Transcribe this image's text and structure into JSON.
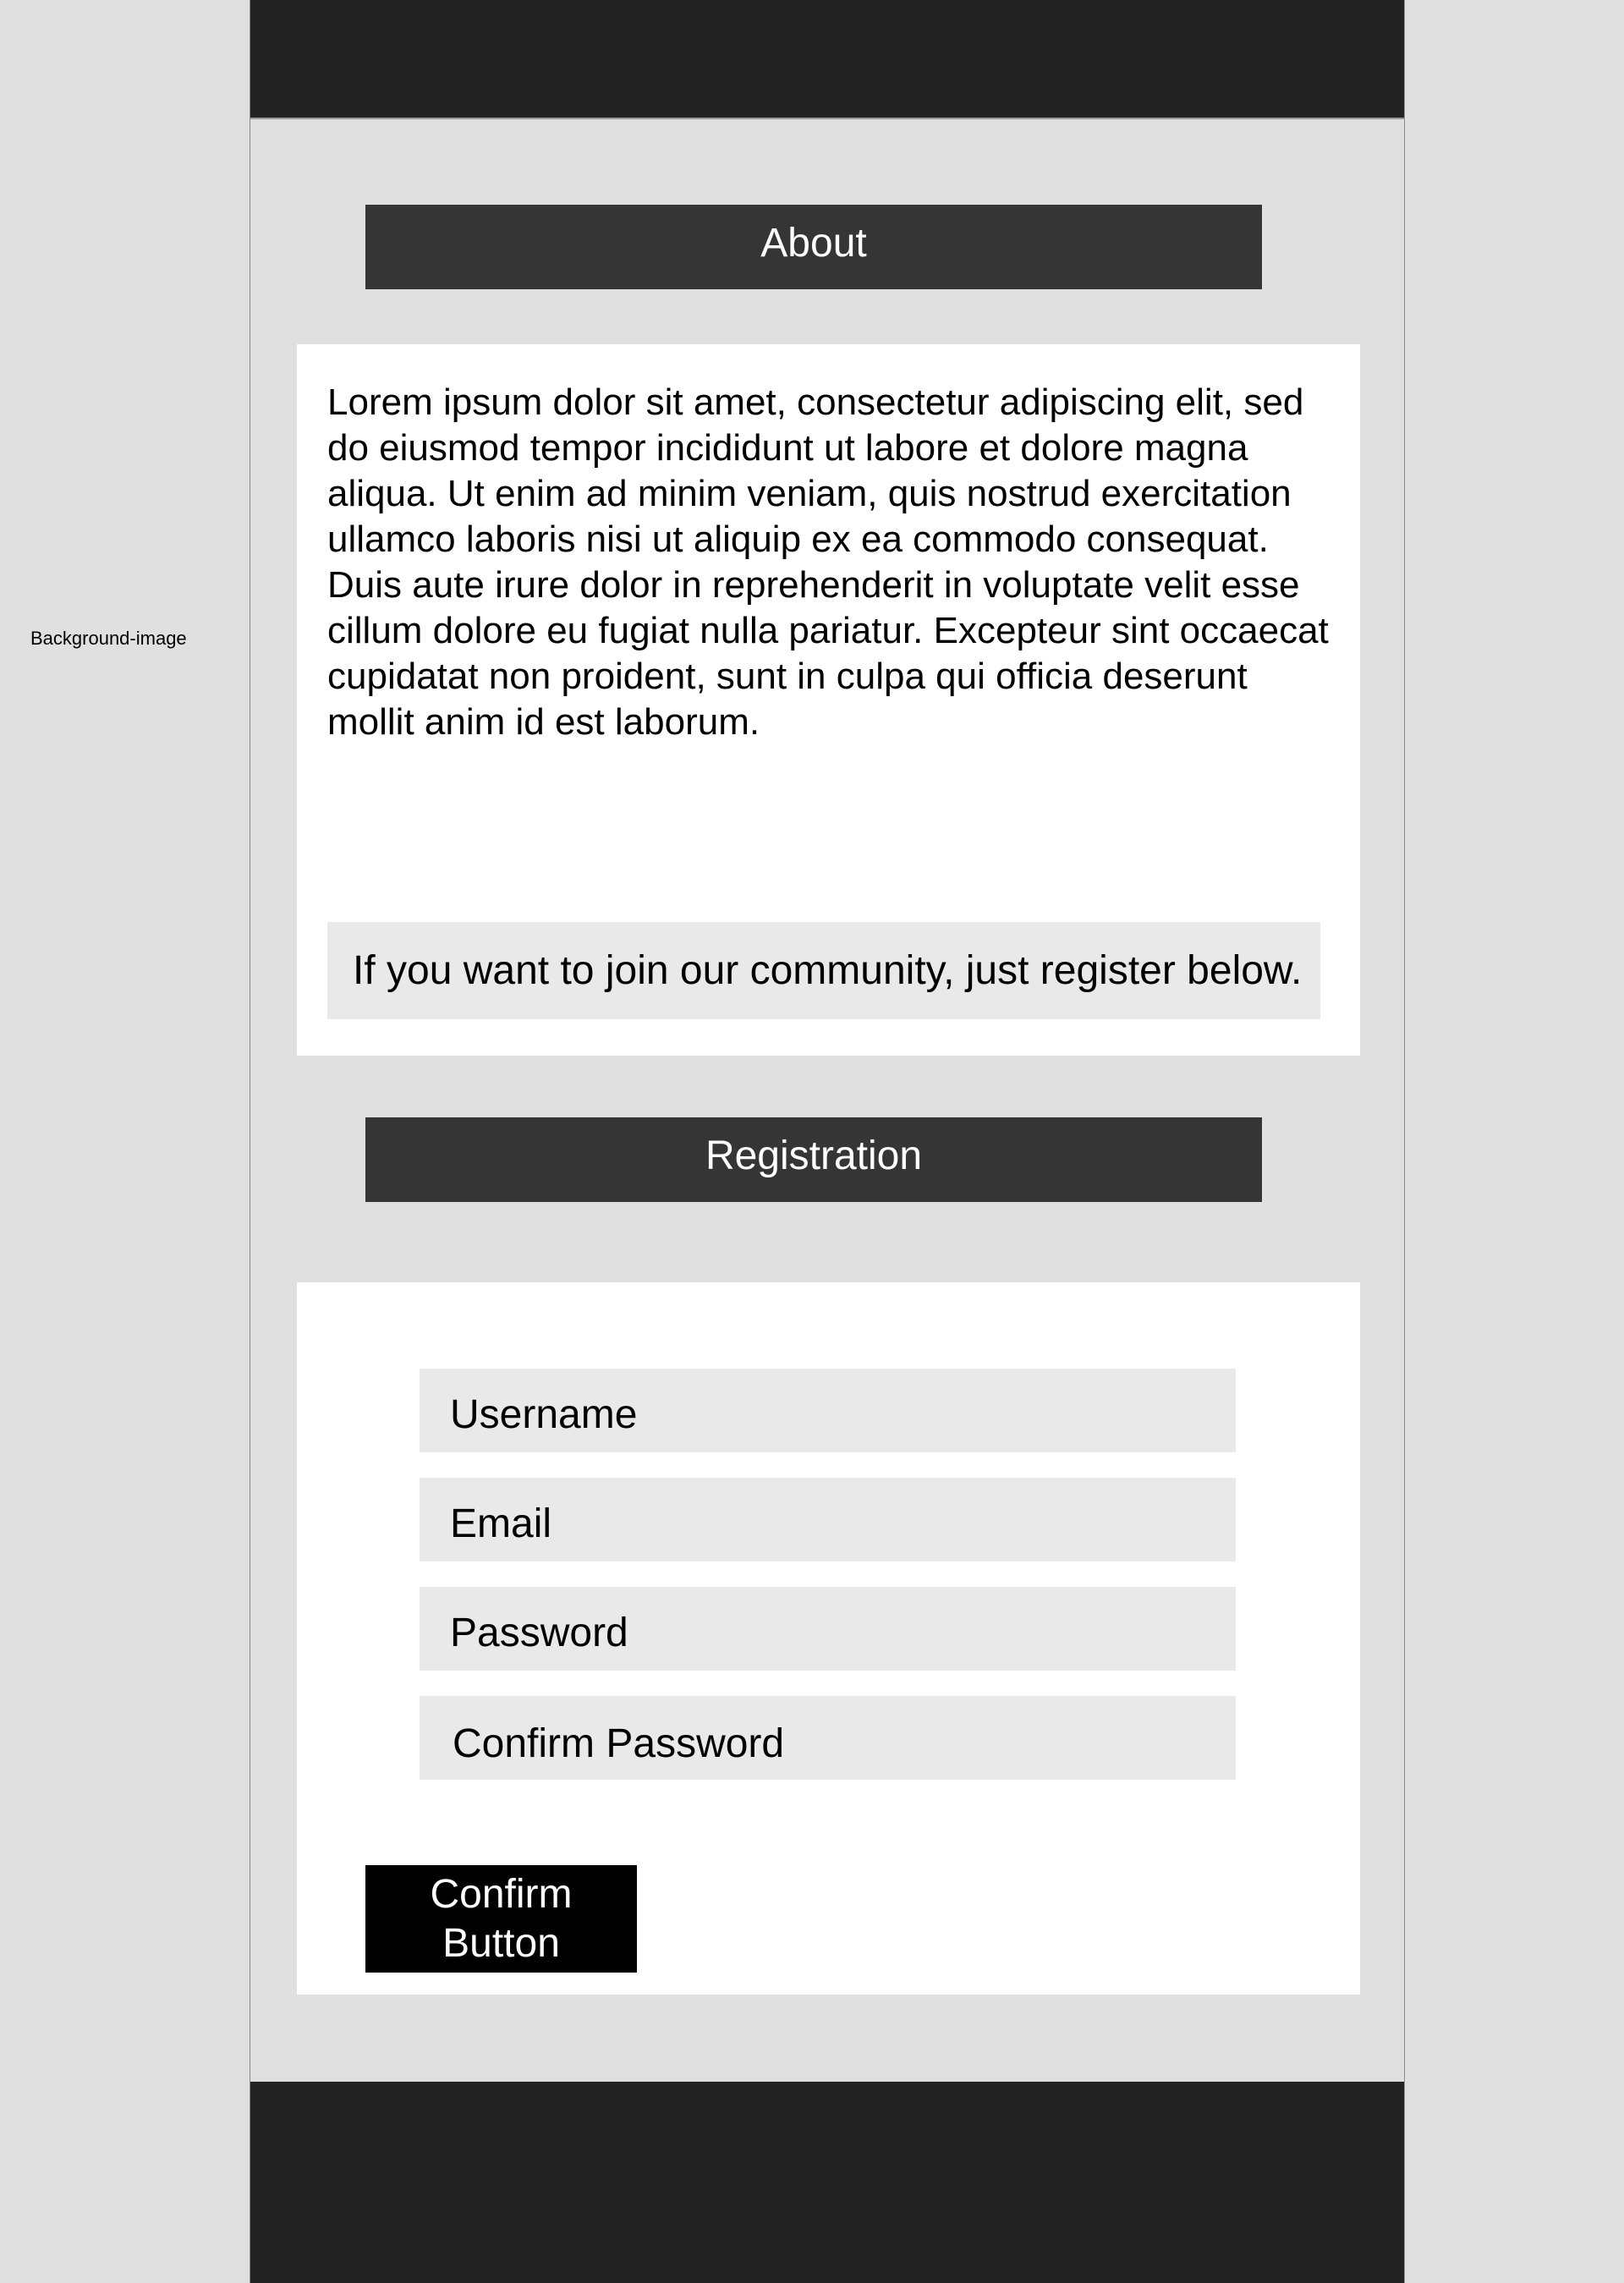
{
  "background": {
    "label": "Background-image"
  },
  "about": {
    "heading": "About",
    "body": "Lorem ipsum dolor sit amet, consectetur adipiscing elit, sed do eiusmod tempor incididunt ut labore et dolore magna aliqua. Ut enim ad minim veniam, quis nostrud exercitation ullamco laboris nisi ut aliquip ex ea commodo consequat. Duis aute irure dolor in reprehenderit in voluptate velit esse cillum dolore eu fugiat nulla pariatur. Excepteur sint occaecat cupidatat non proident, sunt in culpa qui officia deserunt mollit anim id est laborum.",
    "join_text": "If you want to join our community, just register below."
  },
  "registration": {
    "heading": "Registration",
    "fields": {
      "username_placeholder": "Username",
      "email_placeholder": "Email",
      "password_placeholder": "Password",
      "confirm_password_placeholder": "Confirm Password"
    },
    "confirm_button_label": "Confirm Button"
  },
  "colors": {
    "page_background": "#e0e0e0",
    "bar_dark": "#232323",
    "header_dark": "#353535",
    "card": "#ffffff",
    "field": "#e9e9e9",
    "button": "#000000"
  }
}
